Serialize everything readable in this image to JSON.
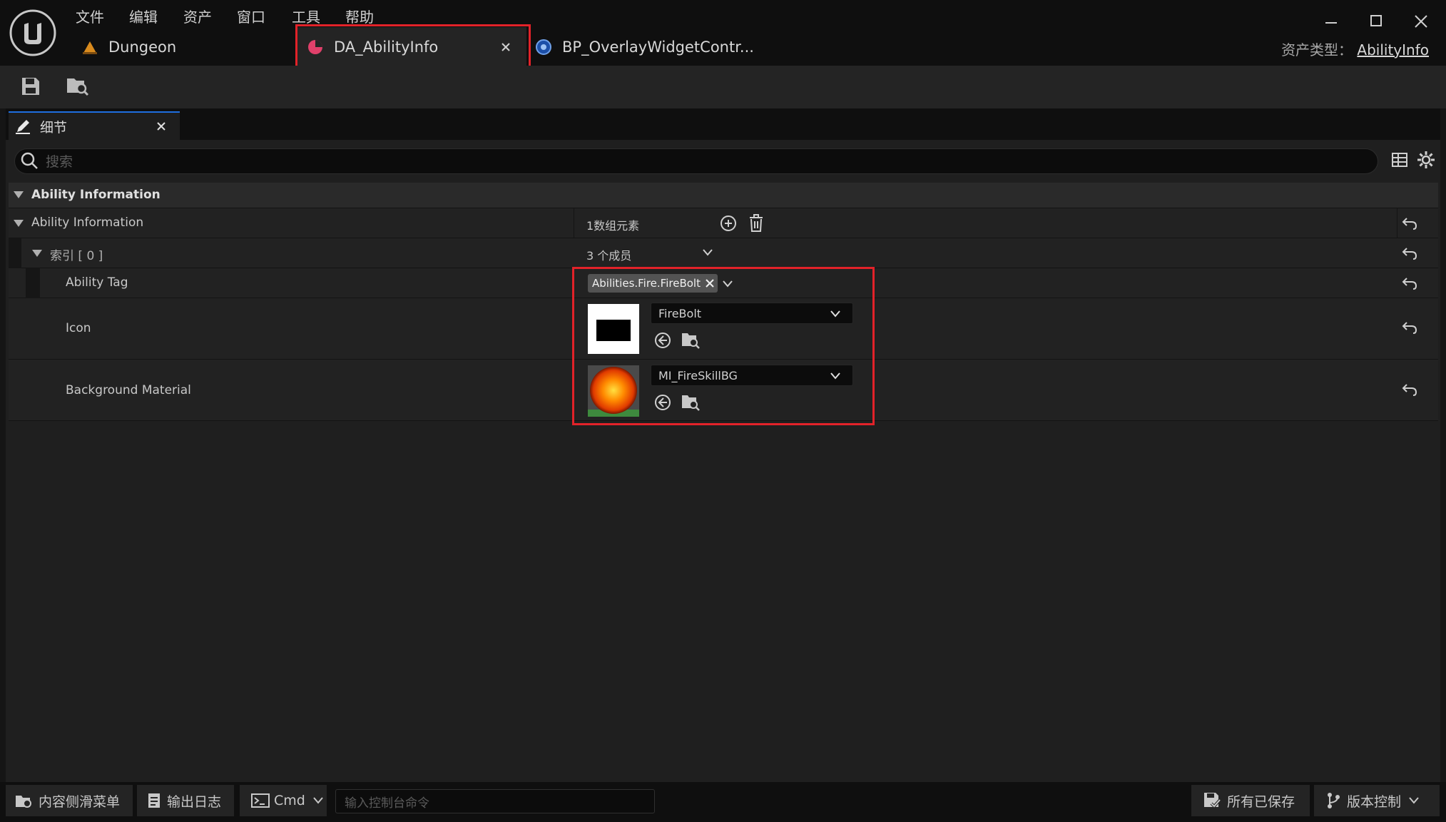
{
  "menu": [
    "文件",
    "编辑",
    "资产",
    "窗口",
    "工具",
    "帮助"
  ],
  "tabs": {
    "dungeon": "Dungeon",
    "ability_info": "DA_AbilityInfo",
    "overlay": "BP_OverlayWidgetContr..."
  },
  "asset_type": {
    "label": "资产类型：",
    "value": "AbilityInfo"
  },
  "details": {
    "tab_label": "细节",
    "search_placeholder": "搜索",
    "category": "Ability Information",
    "array": {
      "name": "Ability Information",
      "summary": "1数组元素"
    },
    "index": {
      "name": "索引 [ 0 ]",
      "summary": "3 个成员"
    },
    "fields": {
      "ability_tag": {
        "name": "Ability Tag",
        "value": "Abilities.Fire.FireBolt"
      },
      "icon": {
        "name": "Icon",
        "value": "FireBolt"
      },
      "background": {
        "name": "Background Material",
        "value": "MI_FireSkillBG"
      }
    }
  },
  "statusbar": {
    "content_drawer": "内容侧滑菜单",
    "output_log": "输出日志",
    "cmd": "Cmd",
    "console_placeholder": "输入控制台命令",
    "all_saved": "所有已保存",
    "source_control": "版本控制"
  },
  "colors": {
    "highlight": "#e22229",
    "tab_active_accent": "#1f6fe0",
    "panel_bg": "#1f1f1f"
  }
}
